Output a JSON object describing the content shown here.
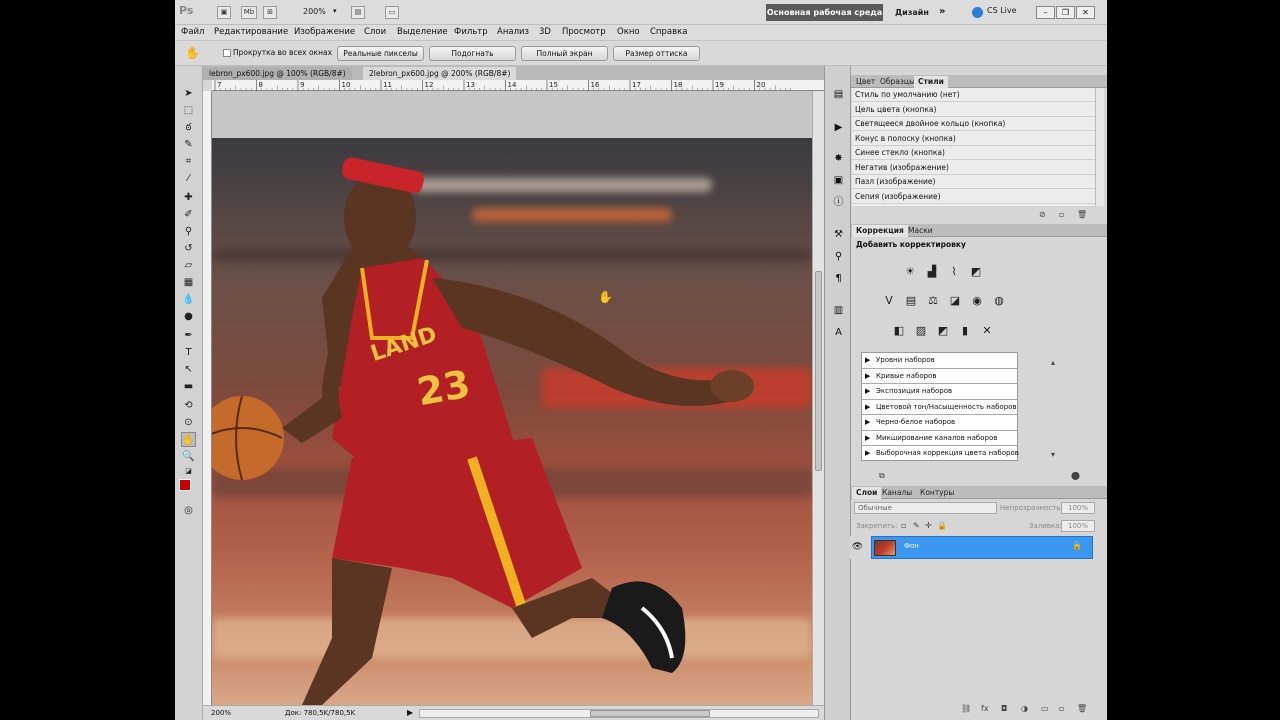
{
  "app": {
    "logo": "Ps",
    "zoom": "200%",
    "workspace": "Основная рабочая среда",
    "design": "Дизайн",
    "more": "»",
    "cslive": "CS Live"
  },
  "menu": [
    "Файл",
    "Редактирование",
    "Изображение",
    "Слои",
    "Выделение",
    "Фильтр",
    "Анализ",
    "3D",
    "Просмотр",
    "Окно",
    "Справка"
  ],
  "options": {
    "scroll_all": "Прокрутка во всех окнах",
    "buttons": [
      "Реальные пикселы",
      "Подогнать",
      "Полный экран",
      "Размер оттиска"
    ]
  },
  "documents": {
    "tabs": [
      "lebron_px600.jpg @ 100% (RGB/8#)",
      "2lebron_px600.jpg @ 200% (RGB/8#)"
    ],
    "active": 1,
    "ruler_marks": [
      "7",
      "8",
      "9",
      "10",
      "11",
      "12",
      "13",
      "14",
      "15",
      "16",
      "17",
      "18",
      "19",
      "20"
    ]
  },
  "status": {
    "zoom": "200%",
    "doc": "Док: 780,5K/780,5K"
  },
  "styles_panel": {
    "tabs": [
      "Цвет",
      "Образцы",
      "Стили"
    ],
    "items": [
      "Стиль по умолчанию (нет)",
      "Цель цвета (кнопка)",
      "Светящееся двойное кольцо (кнопка)",
      "Конус в полоску (кнопка)",
      "Синее стекло (кнопка)",
      "Негатив (изображение)",
      "Пазл (изображение)",
      "Сепия (изображение)"
    ]
  },
  "correction_panel": {
    "tabs": [
      "Коррекция",
      "Маски"
    ],
    "title": "Добавить корректировку",
    "presets": [
      "Уровни наборов",
      "Кривые наборов",
      "Экспозиция наборов",
      "Цветовой тон/Насыщенность наборов",
      "Черно-белое наборов",
      "Микширование каналов наборов",
      "Выборочная коррекция цвета наборов"
    ]
  },
  "layers_panel": {
    "tabs": [
      "Слои",
      "Каналы",
      "Контуры"
    ],
    "blend_mode": "Обычные",
    "opacity_label": "Непрозрачность:",
    "opacity": "100%",
    "lock_label": "Закрепить:",
    "fill_label": "Заливка:",
    "fill": "100%",
    "layer_name": "Фон"
  },
  "colors": {
    "foreground": "#c40000",
    "background": "#ffffff",
    "layer_selected": "#3c97f0"
  }
}
